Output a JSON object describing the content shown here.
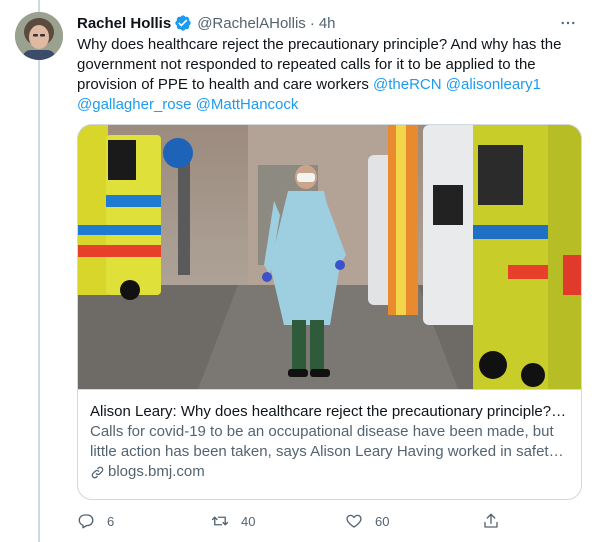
{
  "tweet": {
    "author_name": "Rachel Hollis",
    "author_handle": "@RachelAHollis",
    "separator": "·",
    "time": "4h",
    "text_plain": "Why does healthcare reject the precautionary principle? And why has the government not responded to repeated calls for it to be applied to the provision of PPE to health and care workers ",
    "mentions": [
      "@theRCN",
      "@alisonleary1",
      "@gallagher_rose",
      "@MattHancock"
    ]
  },
  "card": {
    "title": "Alison Leary: Why does healthcare reject the precautionary principle? - ...",
    "description_line1": "Calls for covid-19 to be an occupational disease have been made, but",
    "description_line2": "little action has been taken, says Alison Leary Having worked in safety ...",
    "domain": "blogs.bmj.com"
  },
  "actions": {
    "replies": "6",
    "retweets": "40",
    "likes": "60"
  },
  "colors": {
    "link": "#1d9bf0",
    "verified": "#1d9bf0",
    "secondary_text": "#536471",
    "border": "#cfd9de"
  },
  "icons": [
    "verified-badge-icon",
    "more-icon",
    "link-icon",
    "reply-icon",
    "retweet-icon",
    "like-icon",
    "share-icon"
  ]
}
